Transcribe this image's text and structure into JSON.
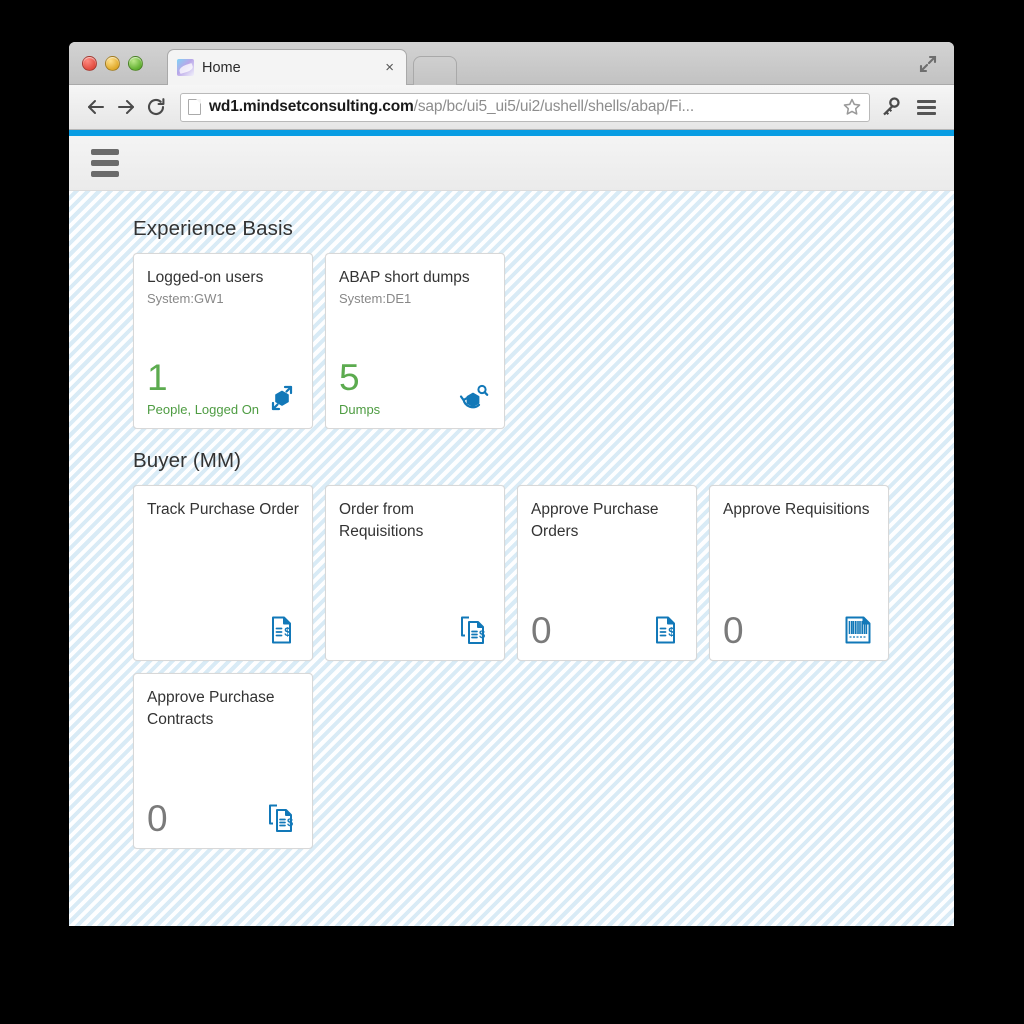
{
  "browser": {
    "tab": {
      "title": "Home",
      "favicon": "sap-fiori-favicon",
      "close_label": "×"
    },
    "new_tab_label": "",
    "toolbar": {
      "back_label": "Back",
      "forward_label": "Forward",
      "reload_label": "Reload",
      "url_host": "wd1.mindsetconsulting.com",
      "url_path": "/sap/bc/ui5_ui5/ui2/ushell/shells/abap/Fi...",
      "url_full": "wd1.mindsetconsulting.com/sap/bc/ui5_ui5/ui2/ushell/shells/abap/Fi...",
      "bookmark_label": "Bookmark this page",
      "key_label": "Passwords",
      "menu_label": "Customize and control"
    },
    "expand_label": "Full screen"
  },
  "shell": {
    "menu_label": "Menu",
    "accent_color": "#089de3"
  },
  "colors": {
    "accent": "#089de3",
    "tile_icon": "#1278b8",
    "kpi_green": "#5cab4f",
    "kpi_grey": "#7a7a7a",
    "canvas": "#eef6fb"
  },
  "groups": [
    {
      "title": "Experience Basis",
      "tiles": [
        {
          "title": "Logged-on users",
          "subtitle": "System:GW1",
          "number": "1",
          "number_color": "green",
          "unit": "People, Logged On",
          "icon": "cube-sync-icon"
        },
        {
          "title": "ABAP short dumps",
          "subtitle": "System:DE1",
          "number": "5",
          "number_color": "green",
          "unit": "Dumps",
          "icon": "cube-search-icon"
        }
      ]
    },
    {
      "title": "Buyer (MM)",
      "tiles": [
        {
          "title": "Track Purchase Order",
          "subtitle": "",
          "number": "",
          "number_color": "grey",
          "unit": "",
          "icon": "document-dollar-icon"
        },
        {
          "title": "Order from Requisitions",
          "subtitle": "",
          "number": "",
          "number_color": "grey",
          "unit": "",
          "icon": "documents-copy-dollar-icon"
        },
        {
          "title": "Approve Purchase Orders",
          "subtitle": "",
          "number": "0",
          "number_color": "grey",
          "unit": "",
          "icon": "document-dollar-icon"
        },
        {
          "title": "Approve Requisitions",
          "subtitle": "",
          "number": "0",
          "number_color": "grey",
          "unit": "",
          "icon": "document-barcode-icon"
        },
        {
          "title": "Approve Purchase Contracts",
          "subtitle": "",
          "number": "0",
          "number_color": "grey",
          "unit": "",
          "icon": "documents-copy-dollar-icon"
        }
      ]
    }
  ]
}
